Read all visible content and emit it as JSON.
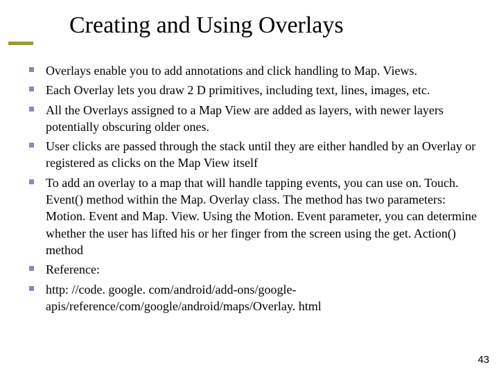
{
  "title": "Creating and Using Overlays",
  "bullets": [
    "Overlays enable you to add annotations and click handling to Map. Views.",
    "Each Overlay lets you draw 2 D primitives, including text, lines, images, etc.",
    "All the Overlays assigned to a Map View are added as layers, with newer layers potentially obscuring older ones.",
    "User clicks are passed through the stack until they are either handled by an Overlay or registered as clicks on the Map View itself",
    "To add an overlay to a map that will handle tapping events, you can use on. Touch. Event() method within the Map. Overlay class. The method has two parameters: Motion. Event and Map. View. Using the Motion. Event parameter, you can determine whether the user has lifted his or her finger from the screen using the get. Action() method",
    "Reference:",
    "http: //code. google. com/android/add-ons/google-apis/reference/com/google/android/maps/Overlay. html"
  ],
  "page_number": "43"
}
